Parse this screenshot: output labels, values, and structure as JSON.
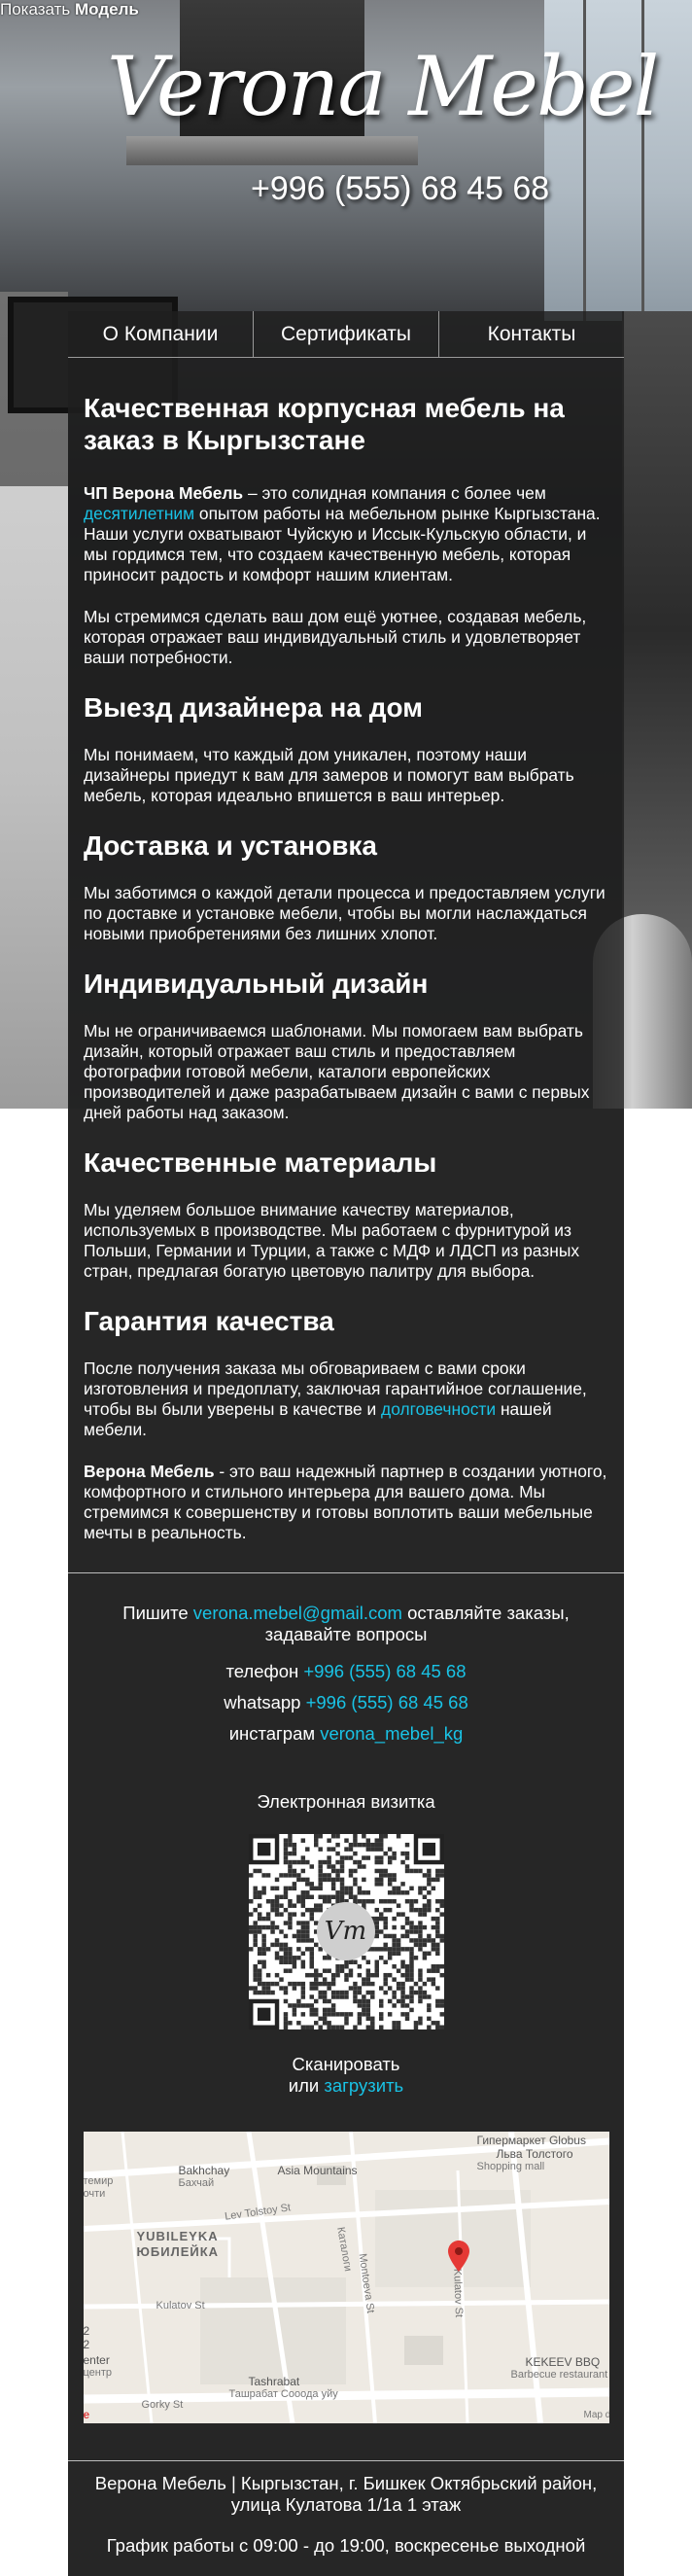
{
  "header": {
    "show_label": "Показать",
    "show_model": "Модель",
    "logo": "Verona Mebel",
    "phone": "+996 (555) 68 45 68"
  },
  "nav": {
    "items": [
      "О Компании",
      "Сертификаты",
      "Контакты"
    ]
  },
  "intro": {
    "title": "Качественная корпусная мебель на заказ в Кыргызстане",
    "p1_bold": "ЧП Верона Мебель",
    "p1_a": " – это солидная компания с более чем ",
    "p1_link": "десятилетним",
    "p1_b": " опытом работы на мебельном рынке Кыргызстана. Наши услуги охватывают Чуйскую и Иссык-Кульскую области, и мы гордимся тем, что создаем качественную мебель, которая приносит радость и комфорт нашим клиентам.",
    "p2": "Мы стремимся сделать ваш дом ещё уютнее, создавая мебель, которая отражает ваш индивидуальный стиль и удовлетворяет ваши потребности."
  },
  "sections": [
    {
      "title": "Выезд дизайнера на дом",
      "text": "Мы понимаем, что каждый дом уникален, поэтому наши дизайнеры приедут к вам для замеров и помогут вам выбрать мебель, которая идеально впишется в ваш интерьер."
    },
    {
      "title": "Доставка и установка",
      "text": "Мы заботимся о каждой детали процесса и предоставляем услуги по доставке и установке мебели, чтобы вы могли наслаждаться новыми приобретениями без лишних хлопот."
    },
    {
      "title": "Индивидуальный дизайн",
      "text": "Мы не ограничиваемся шаблонами. Мы помогаем вам выбрать дизайн, который отражает ваш стиль и предоставляем фотографии готовой мебели, каталоги европейских производителей и даже разрабатываем дизайн с вами с первых дней работы над заказом."
    },
    {
      "title": "Качественные материалы",
      "text": "Мы уделяем большое внимание качеству материалов, используемых в производстве. Мы работаем с фурнитурой из Польши, Германии и Турции, а также с МДФ и ЛДСП из разных стран, предлагая богатую цветовую палитру для выбора."
    }
  ],
  "guarantee": {
    "title": "Гарантия качества",
    "text_a": "После получения заказа мы обговариваем с вами сроки изготовления и предоплату, заключая гарантийное соглашение, чтобы вы были уверены в качестве и ",
    "text_link": "долговечности",
    "text_b": " нашей мебели.",
    "closing_bold": "Верона Мебель",
    "closing_text": " - это ваш надежный партнер в создании уютного, комфортного и стильного интерьера для вашего дома. Мы стремимся к совершенству и готовы воплотить ваши мебельные мечты в реальность."
  },
  "contacts": {
    "write_a": "Пишите ",
    "email": "verona.mebel@gmail.com",
    "write_b": " оставляйте заказы, задавайте вопросы",
    "phone_label": "телефон ",
    "phone": "+996 (555) 68 45 68",
    "whatsapp_label": "whatsapp ",
    "whatsapp": "+996 (555) 68 45 68",
    "instagram_label": "инстаграм ",
    "instagram": "verona_mebel_kg",
    "vcard_title": "Электронная визитка",
    "qr_logo": "Vm",
    "scan_line1": "Сканировать",
    "scan_line2_a": "или ",
    "scan_line2_link": "загрузить"
  },
  "map": {
    "labels": {
      "globus": "Гипермаркет Globus",
      "tolstogo": "Льва Толстого",
      "shopping": "Shopping mall",
      "bakhchay": "Bakhchay",
      "bakhchay_ru": "Бахчай",
      "asia": "Asia Mountains",
      "temir": "темир",
      "ochti": "очти",
      "lev": "Lev Tolstoy St",
      "yubileyka": "YUBILEYKA",
      "yubileyka_ru": "ЮБИЛЕЙКА",
      "katalog": "Каталоги",
      "montoeva": "Montoeva St",
      "kulatov_v": "Kulatov St",
      "kulatov_h": "Kulatov St",
      "two_a": "2",
      "two_b": "2",
      "enter": "enter",
      "centr": "центр",
      "tashrabat": "Tashrabat",
      "tashrabat_ru": "Ташрабат Сооода уйу",
      "kekeev": "KEKEEV BBQ",
      "barbecue": "Barbecue restaurant",
      "gorky": "Gorky St",
      "map_data": "Map d",
      "google_e": "e"
    }
  },
  "footer": {
    "address": "Верона Мебель | Кыргызстан, г. Бишкек Октябрьский район, улица Кулатова 1/1а 1 этаж",
    "hours": "График работы с 09:00 - до 19:00, воскресенье выходной"
  }
}
